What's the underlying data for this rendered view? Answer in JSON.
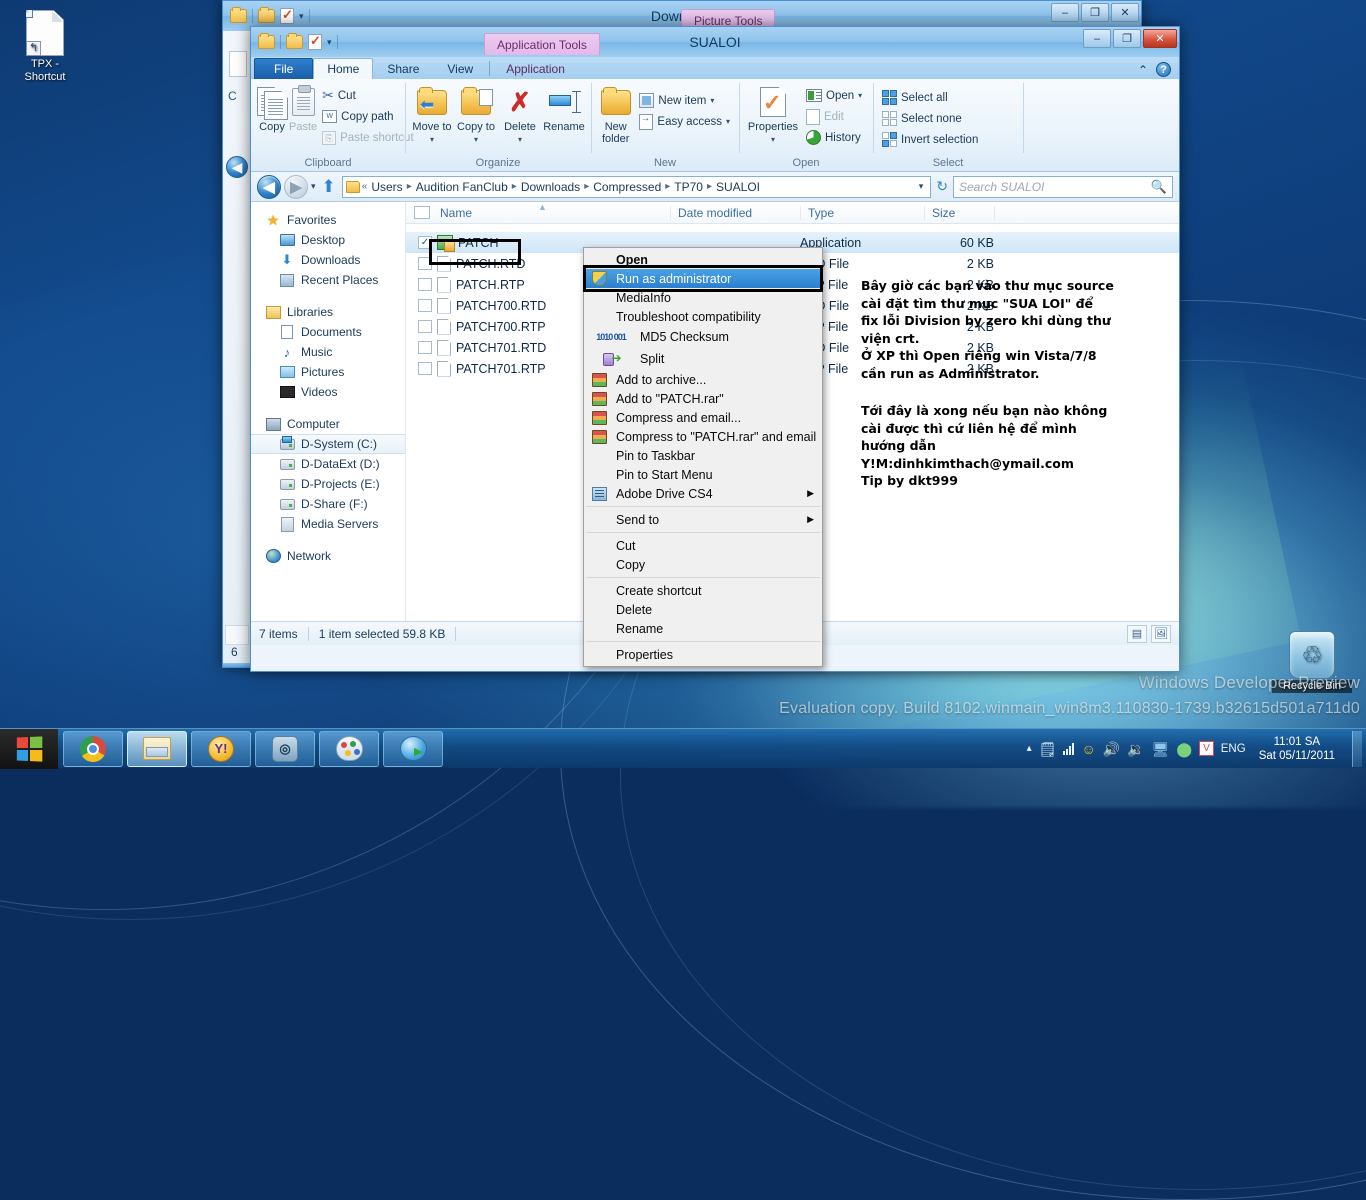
{
  "desktop": {
    "icons": [
      {
        "name": "TPX - Shortcut",
        "line1": "TPX -",
        "line2": "Shortcut",
        "icon": "shortcut-file-icon"
      },
      {
        "name": "Recycle Bin",
        "line1": "Recycle Bin",
        "line2": "",
        "icon": "recycle-bin-icon"
      }
    ],
    "watermark_line1": "Windows Developer Preview",
    "watermark_line2": "Evaluation copy. Build 8102.winmain_win8m3.110830-1739.b32615d501a711d0"
  },
  "background_window": {
    "title": "Download",
    "contextual_tab": "Picture Tools",
    "buttons": {
      "minimize": "–",
      "maximize": "❐",
      "close": "✕"
    },
    "status_fragment": "6"
  },
  "window": {
    "title": "SUALOI",
    "contextual_tab": "Application Tools",
    "buttons": {
      "minimize": "–",
      "maximize": "❐",
      "close": "✕"
    },
    "quick_access": [
      "folder-icon",
      "folder-icon",
      "properties-icon",
      "dropdown-caret"
    ],
    "tabs": [
      {
        "label": "File",
        "kind": "file"
      },
      {
        "label": "Home",
        "kind": "active"
      },
      {
        "label": "Share",
        "kind": "normal"
      },
      {
        "label": "View",
        "kind": "normal"
      },
      {
        "label": "Application",
        "kind": "contextual"
      }
    ],
    "tab_right": {
      "minimize_ribbon": "⌃",
      "help": "?"
    }
  },
  "ribbon": {
    "groups": [
      {
        "name": "Clipboard",
        "big": [
          {
            "label": "Copy",
            "icon": "copy-icon",
            "disabled": false
          },
          {
            "label": "Paste",
            "icon": "paste-icon",
            "disabled": true
          }
        ],
        "small": [
          {
            "label": "Cut",
            "icon": "scissors-icon",
            "disabled": false
          },
          {
            "label": "Copy path",
            "icon": "copy-path-icon",
            "disabled": false
          },
          {
            "label": "Paste shortcut",
            "icon": "paste-shortcut-icon",
            "disabled": true
          }
        ]
      },
      {
        "name": "Organize",
        "big": [
          {
            "label": "Move to",
            "icon": "move-to-icon",
            "dropdown": true
          },
          {
            "label": "Copy to",
            "icon": "copy-to-icon",
            "dropdown": true
          },
          {
            "label": "Delete",
            "icon": "delete-icon",
            "dropdown": true
          },
          {
            "label": "Rename",
            "icon": "rename-icon",
            "dropdown": false
          }
        ],
        "small": []
      },
      {
        "name": "New",
        "big": [
          {
            "label": "New folder",
            "icon": "new-folder-icon",
            "dropdown": false
          }
        ],
        "small": [
          {
            "label": "New item",
            "icon": "new-item-icon",
            "dropdown": true
          },
          {
            "label": "Easy access",
            "icon": "easy-access-icon",
            "dropdown": true
          }
        ]
      },
      {
        "name": "Open",
        "big": [
          {
            "label": "Properties",
            "icon": "properties-icon",
            "dropdown": true
          }
        ],
        "small": [
          {
            "label": "Open",
            "icon": "open-icon",
            "dropdown": true,
            "disabled": false
          },
          {
            "label": "Edit",
            "icon": "edit-icon",
            "disabled": true
          },
          {
            "label": "History",
            "icon": "history-icon",
            "disabled": false
          }
        ]
      },
      {
        "name": "Select",
        "big": [],
        "small": [
          {
            "label": "Select all",
            "icon": "select-all-icon"
          },
          {
            "label": "Select none",
            "icon": "select-none-icon"
          },
          {
            "label": "Invert selection",
            "icon": "invert-selection-icon"
          }
        ]
      }
    ]
  },
  "addressbar": {
    "back": "back-icon",
    "forward": "forward-icon",
    "recent_caret": "▾",
    "up": "up-icon",
    "crumbs": [
      "Users",
      "Audition FanClub",
      "Downloads",
      "Compressed",
      "TP70",
      "SUALOI"
    ],
    "crumb_prefix": "«",
    "refresh": "refresh-icon",
    "search_placeholder": "Search SUALOI"
  },
  "navpane": {
    "groups": [
      {
        "head": {
          "label": "Favorites",
          "icon": "favorites-star-icon"
        },
        "items": [
          {
            "label": "Desktop",
            "icon": "desktop-icon"
          },
          {
            "label": "Downloads",
            "icon": "downloads-icon"
          },
          {
            "label": "Recent Places",
            "icon": "recent-places-icon"
          }
        ]
      },
      {
        "head": {
          "label": "Libraries",
          "icon": "libraries-icon"
        },
        "items": [
          {
            "label": "Documents",
            "icon": "documents-icon"
          },
          {
            "label": "Music",
            "icon": "music-icon"
          },
          {
            "label": "Pictures",
            "icon": "pictures-icon"
          },
          {
            "label": "Videos",
            "icon": "videos-icon"
          }
        ]
      },
      {
        "head": {
          "label": "Computer",
          "icon": "computer-icon"
        },
        "items": [
          {
            "label": "D-System (C:)",
            "icon": "system-drive-icon",
            "selected": true
          },
          {
            "label": "D-DataExt (D:)",
            "icon": "drive-icon"
          },
          {
            "label": "D-Projects (E:)",
            "icon": "drive-icon"
          },
          {
            "label": "D-Share (F:)",
            "icon": "drive-icon"
          },
          {
            "label": "Media Servers",
            "icon": "media-server-icon"
          }
        ]
      },
      {
        "head": {
          "label": "Network",
          "icon": "network-icon"
        },
        "items": []
      }
    ]
  },
  "filelist": {
    "columns": [
      "Name",
      "Date modified",
      "Type",
      "Size"
    ],
    "rows": [
      {
        "name": "PATCH",
        "date": "",
        "type": "Application",
        "size": "60 KB",
        "icon": "application-icon",
        "checked": true,
        "selected": true
      },
      {
        "name": "PATCH.RTD",
        "date": "",
        "type": "RTD File",
        "size": "2 KB",
        "icon": "file-icon",
        "checked": false,
        "selected": false
      },
      {
        "name": "PATCH.RTP",
        "date": "",
        "type": "RTP File",
        "size": "2 KB",
        "icon": "file-icon",
        "checked": false,
        "selected": false
      },
      {
        "name": "PATCH700.RTD",
        "date": "",
        "type": "RTD File",
        "size": "2 KB",
        "icon": "file-icon",
        "checked": false,
        "selected": false
      },
      {
        "name": "PATCH700.RTP",
        "date": "",
        "type": "RTP File",
        "size": "2 KB",
        "icon": "file-icon",
        "checked": false,
        "selected": false
      },
      {
        "name": "PATCH701.RTD",
        "date": "",
        "type": "RTD File",
        "size": "2 KB",
        "icon": "file-icon",
        "checked": false,
        "selected": false
      },
      {
        "name": "PATCH701.RTP",
        "date": "",
        "type": "RTP File",
        "size": "2 KB",
        "icon": "file-icon",
        "checked": false,
        "selected": false
      }
    ]
  },
  "context_menu": {
    "items": [
      {
        "label": "Open",
        "icon": "",
        "bold": true,
        "highlight": false
      },
      {
        "label": "Run as administrator",
        "icon": "shield-icon",
        "bold": false,
        "highlight": true
      },
      {
        "label": "MediaInfo",
        "icon": "",
        "bold": false,
        "highlight": false
      },
      {
        "label": "Troubleshoot compatibility",
        "icon": "",
        "bold": false,
        "highlight": false
      },
      {
        "label": "MD5 Checksum",
        "icon": "md5-icon",
        "bold": false,
        "highlight": false
      },
      {
        "label": "Split",
        "icon": "split-icon",
        "bold": false,
        "highlight": false
      },
      {
        "label": "Add to archive...",
        "icon": "winrar-icon",
        "bold": false,
        "highlight": false
      },
      {
        "label": "Add to \"PATCH.rar\"",
        "icon": "winrar-icon",
        "bold": false,
        "highlight": false
      },
      {
        "label": "Compress and email...",
        "icon": "winrar-icon",
        "bold": false,
        "highlight": false
      },
      {
        "label": "Compress to \"PATCH.rar\" and email",
        "icon": "winrar-icon",
        "bold": false,
        "highlight": false
      },
      {
        "label": "Pin to Taskbar",
        "icon": "",
        "bold": false,
        "highlight": false
      },
      {
        "label": "Pin to Start Menu",
        "icon": "",
        "bold": false,
        "highlight": false
      },
      {
        "label": "Adobe Drive CS4",
        "icon": "adobe-drive-icon",
        "bold": false,
        "highlight": false,
        "submenu": true
      },
      {
        "separator": true
      },
      {
        "label": "Send to",
        "icon": "",
        "bold": false,
        "highlight": false,
        "submenu": true
      },
      {
        "separator": true
      },
      {
        "label": "Cut",
        "icon": "",
        "bold": false,
        "highlight": false
      },
      {
        "label": "Copy",
        "icon": "",
        "bold": false,
        "highlight": false
      },
      {
        "separator": true
      },
      {
        "label": "Create shortcut",
        "icon": "",
        "bold": false,
        "highlight": false
      },
      {
        "label": "Delete",
        "icon": "",
        "bold": false,
        "highlight": false
      },
      {
        "label": "Rename",
        "icon": "",
        "bold": false,
        "highlight": false
      },
      {
        "separator": true
      },
      {
        "label": "Properties",
        "icon": "",
        "bold": false,
        "highlight": false
      }
    ]
  },
  "annotation": {
    "block1": "Bây giờ các bạn vào thư mục source\ncài đặt tìm thư mục \"SUA LOI\" để\nfix lỗi Division by zero khi dùng thư\nviện crt.\nỞ XP thì Open riêng win Vista/7/8\ncần run as Administrator.",
    "block2": "Tới đây là xong nếu bạn nào không\ncài được thì cứ liên hệ để mình\nhướng dẫn\nY!M:dinhkimthach@ymail.com\nTip by dkt999"
  },
  "statusbar": {
    "items_count": "7 items",
    "selection": "1 item selected  59.8 KB",
    "view_buttons": [
      "details-view-icon",
      "large-icons-view-icon"
    ]
  },
  "taskbar": {
    "start": "windows-start-icon",
    "buttons": [
      {
        "name": "google-chrome",
        "icon": "chrome-icon",
        "active": false
      },
      {
        "name": "windows-explorer",
        "icon": "explorer-icon",
        "active": true
      },
      {
        "name": "yahoo-messenger",
        "icon": "yahoo-icon",
        "active": false
      },
      {
        "name": "audition",
        "icon": "audition-icon",
        "active": false
      },
      {
        "name": "paint",
        "icon": "paint-icon",
        "active": false
      },
      {
        "name": "internet-download-manager",
        "icon": "idm-icon",
        "active": false
      }
    ],
    "tray": {
      "expand": "▴",
      "icons": [
        "action-center-icon",
        "network-signal-icon",
        "messenger-smiley-icon",
        "volume-icon",
        "volume-alt-icon",
        "display-icon",
        "idm-tray-icon",
        "antivirus-icon"
      ],
      "language": "ENG",
      "time": "11:01 SA",
      "date": "Sat 05/11/2011"
    }
  },
  "colors": {
    "accent": "#2a7fcf",
    "highlight": "#2a7fcf",
    "close_red": "#c0392b",
    "contextual_tab": "#e3b9ea"
  }
}
